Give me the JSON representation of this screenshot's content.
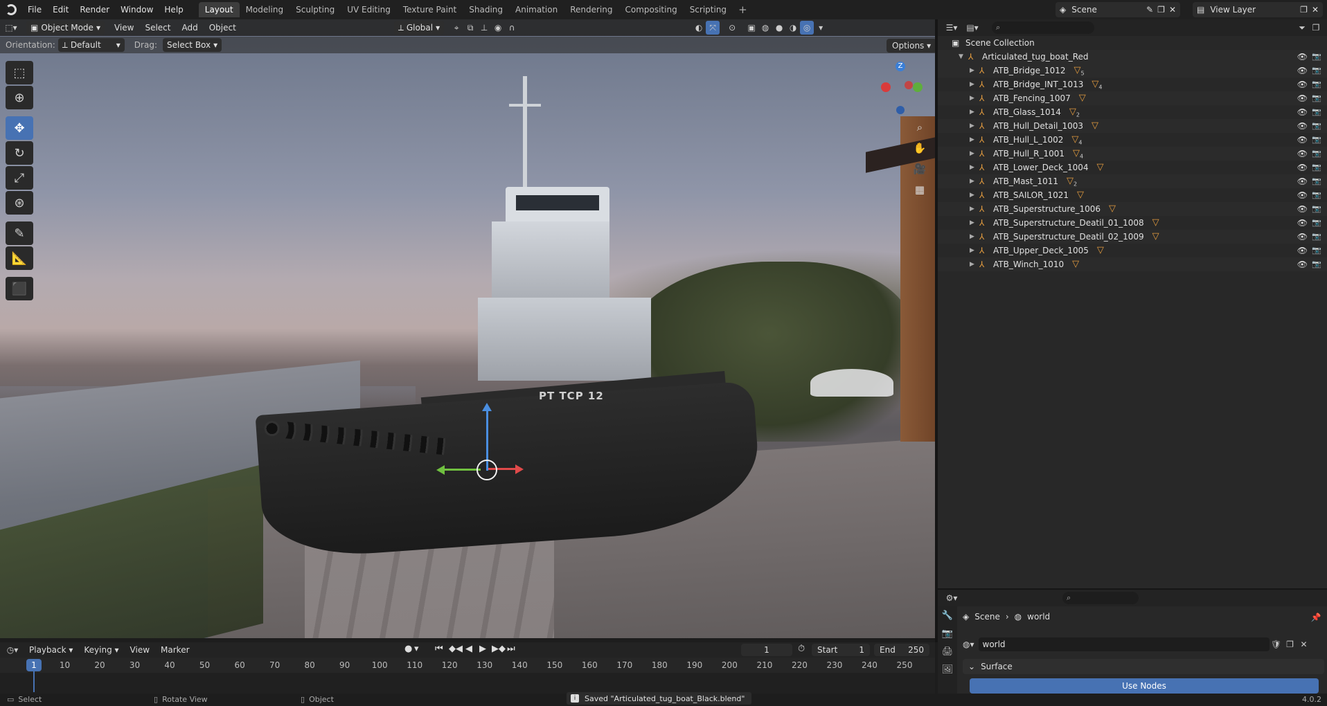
{
  "topbar": {
    "menus": [
      "File",
      "Edit",
      "Render",
      "Window",
      "Help"
    ],
    "workspaces": [
      "Layout",
      "Modeling",
      "Sculpting",
      "UV Editing",
      "Texture Paint",
      "Shading",
      "Animation",
      "Rendering",
      "Compositing",
      "Scripting"
    ],
    "active_workspace": "Layout",
    "scene": "Scene",
    "view_layer": "View Layer"
  },
  "viewport": {
    "mode": "Object Mode",
    "menus": [
      "View",
      "Select",
      "Add",
      "Object"
    ],
    "transform_orientation": "Global",
    "orientation_label": "Orientation:",
    "orientation_value": "Default",
    "drag_label": "Drag:",
    "drag_value": "Select Box",
    "options_label": "Options",
    "boat_text": "PT TCP  12",
    "gizmo_axis_z": "Z"
  },
  "outliner": {
    "collection": "Scene Collection",
    "root": "Articulated_tug_boat_Red",
    "items": [
      {
        "name": "ATB_Bridge_1012",
        "badge": "5"
      },
      {
        "name": "ATB_Bridge_INT_1013",
        "badge": "4"
      },
      {
        "name": "ATB_Fencing_1007",
        "badge": ""
      },
      {
        "name": "ATB_Glass_1014",
        "badge": "2"
      },
      {
        "name": "ATB_Hull_Detail_1003",
        "badge": ""
      },
      {
        "name": "ATB_Hull_L_1002",
        "badge": "4"
      },
      {
        "name": "ATB_Hull_R_1001",
        "badge": "4"
      },
      {
        "name": "ATB_Lower_Deck_1004",
        "badge": ""
      },
      {
        "name": "ATB_Mast_1011",
        "badge": "2"
      },
      {
        "name": "ATB_SAILOR_1021",
        "badge": ""
      },
      {
        "name": "ATB_Superstructure_1006",
        "badge": ""
      },
      {
        "name": "ATB_Superstructure_Deatil_01_1008",
        "badge": ""
      },
      {
        "name": "ATB_Superstructure_Deatil_02_1009",
        "badge": ""
      },
      {
        "name": "ATB_Upper_Deck_1005",
        "badge": ""
      },
      {
        "name": "ATB_Winch_1010",
        "badge": ""
      }
    ]
  },
  "properties": {
    "crumb_scene": "Scene",
    "crumb_world": "world",
    "world_name": "world",
    "surface_label": "Surface",
    "use_nodes_label": "Use Nodes"
  },
  "timeline": {
    "menus": [
      "Playback",
      "Keying",
      "View",
      "Marker"
    ],
    "current_frame": "1",
    "start_label": "Start",
    "start_value": "1",
    "end_label": "End",
    "end_value": "250",
    "ticks": [
      "10",
      "20",
      "30",
      "40",
      "50",
      "60",
      "70",
      "80",
      "90",
      "100",
      "110",
      "120",
      "130",
      "140",
      "150",
      "160",
      "170",
      "180",
      "190",
      "200",
      "210",
      "220",
      "230",
      "240",
      "250"
    ]
  },
  "statusbar": {
    "select": "Select",
    "rotate_view": "Rotate View",
    "object": "Object",
    "saved_message": "Saved \"Articulated_tug_boat_Black.blend\"",
    "version": "4.0.2"
  },
  "colors": {
    "accent": "#4772b3",
    "object_icon": "#e49c3f"
  }
}
